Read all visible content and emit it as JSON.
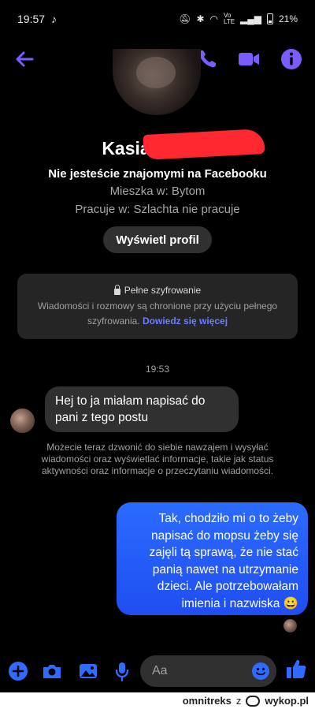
{
  "status_bar": {
    "time": "19:57",
    "battery": "21%",
    "network": "Vo LTE",
    "app_icon": "tiktok-icon",
    "icons": [
      "mute-icon",
      "bluetooth-icon",
      "wifi-icon",
      "signal-icon",
      "battery-icon"
    ]
  },
  "header": {
    "icons": [
      "back-arrow-icon",
      "phone-icon",
      "video-camera-icon",
      "info-icon"
    ],
    "accent_color": "#7a5cff"
  },
  "profile": {
    "name": "Kasia",
    "friendship": "Nie jesteście znajomymi na Facebooku",
    "lives_in": "Mieszka w: Bytom",
    "works_at": "Pracuje w: Szlachta nie pracuje",
    "view_profile_label": "Wyświetl profil"
  },
  "encryption": {
    "title": "Pełne szyfrowanie",
    "body": "Wiadomości i rozmowy są chronione przy użyciu pełnego szyfrowania.",
    "link": "Dowiedz się więcej"
  },
  "timestamp": "19:53",
  "messages": {
    "incoming": "Hej to ja miałam napisać do pani z tego postu",
    "notice": "Możecie teraz dzwonić do siebie nawzajem i wysyłać wiadomości oraz wyświetlać informacje, takie jak status aktywności oraz informacje o przeczytaniu wiadomości.",
    "outgoing": "Tak, chodziło mi o to żeby napisać do mopsu żeby się zajęli tą sprawą, że nie stać panią nawet na utrzymanie dzieci. Ale potrzebowałam imienia i nazwiska 😀"
  },
  "composer": {
    "placeholder": "Aa",
    "icons": [
      "plus-icon",
      "camera-icon",
      "gallery-icon",
      "microphone-icon",
      "emoji-icon",
      "like-icon"
    ]
  },
  "footer": {
    "author": "omnitreks",
    "z": "z",
    "site": "wykop.pl"
  },
  "colors": {
    "accent": "#7a5cff",
    "outgoing_bubble": "#2460ff",
    "incoming_bubble": "#303030",
    "link": "#6d7dff"
  }
}
